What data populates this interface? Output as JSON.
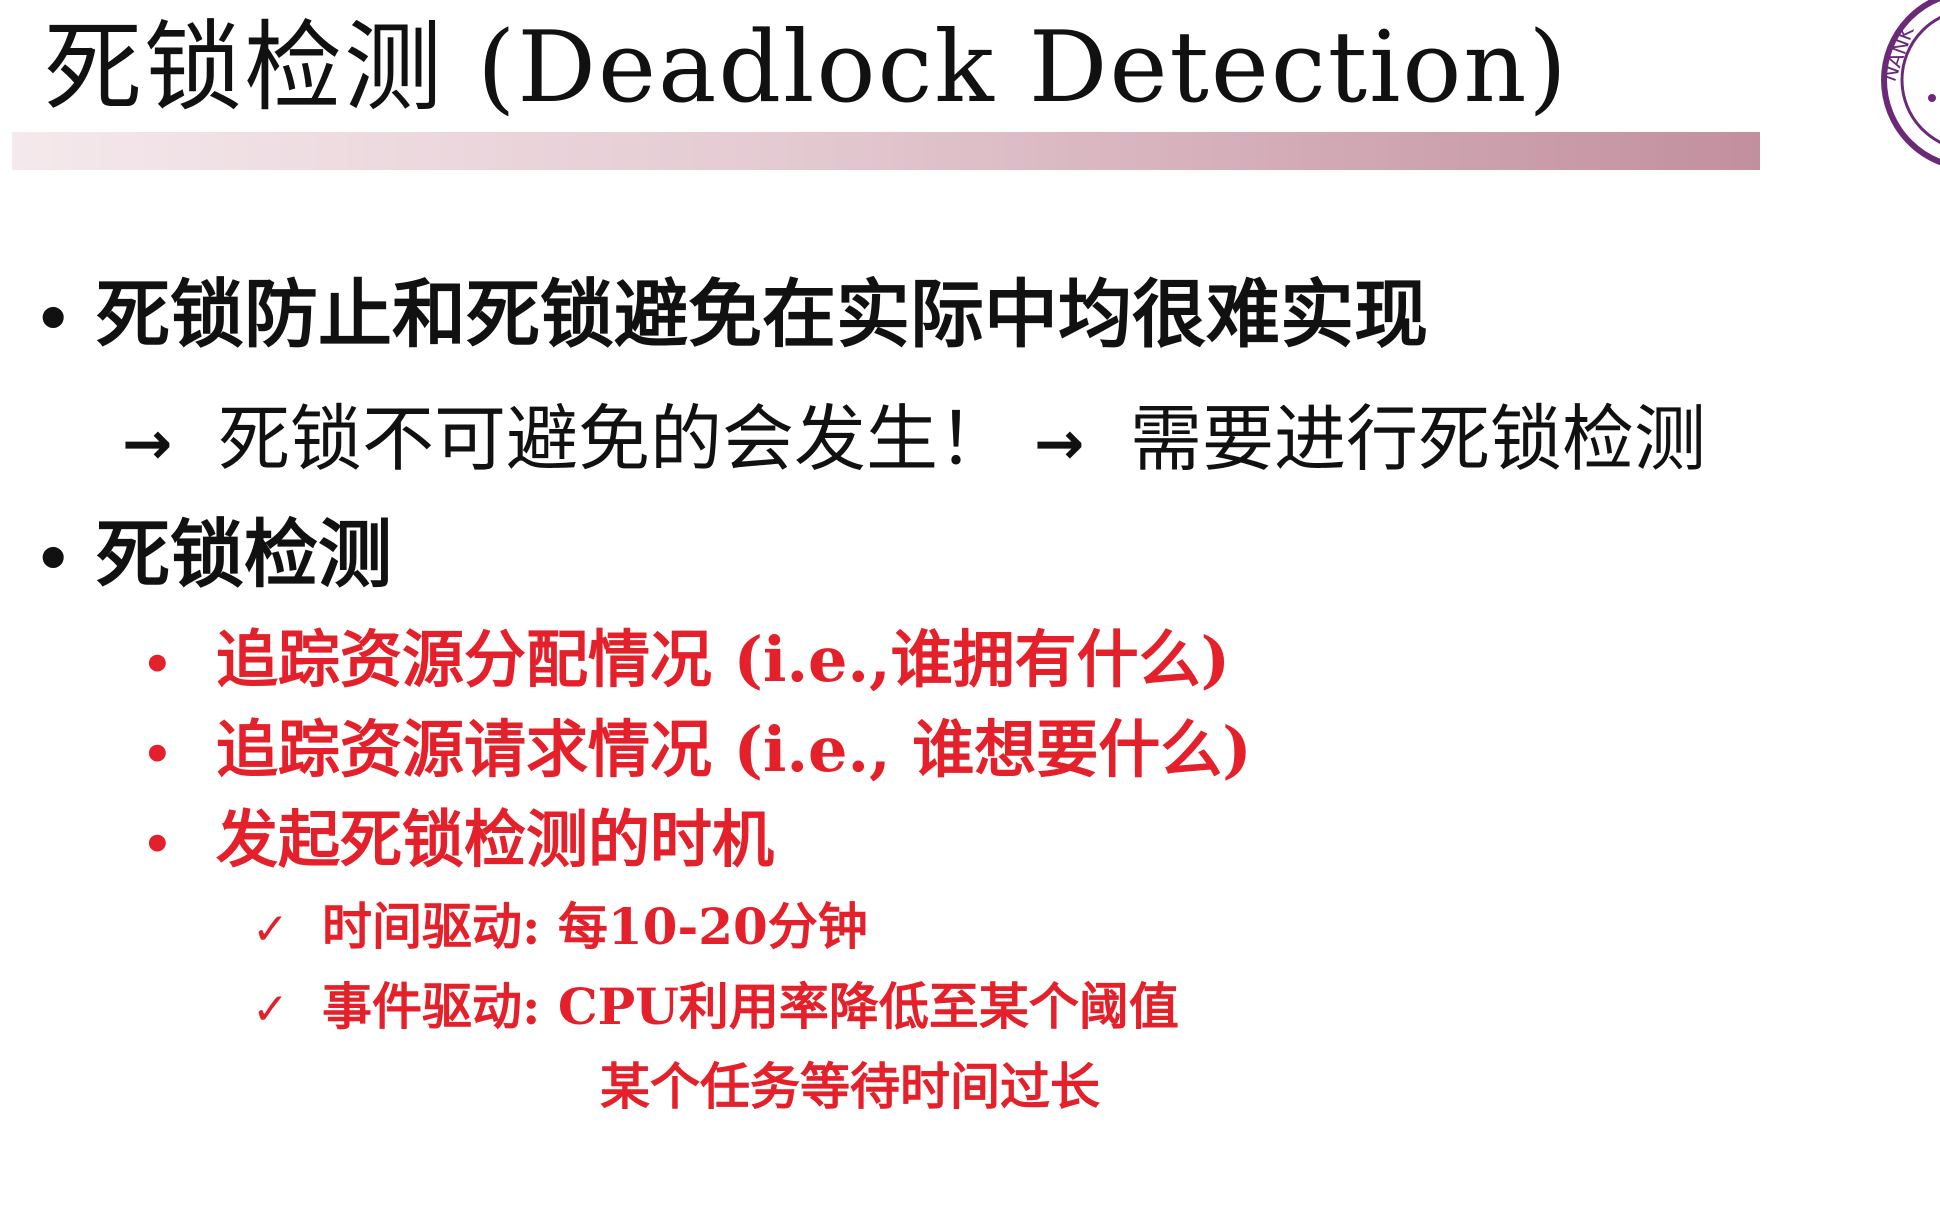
{
  "slide": {
    "title": "死锁检测  (Deadlock Detection)",
    "logo_text": "NANK",
    "bullet_1": "死锁防止和死锁避免在实际中均很难实现",
    "arrow_line": {
      "part_1": "死锁不可避免的会发生！",
      "part_2": "需要进行死锁检测"
    },
    "bullet_2": "死锁检测",
    "sub_bullets": [
      "追踪资源分配情况 (i.e.,谁拥有什么)",
      "追踪资源请求情况 (i.e., 谁想要什么)",
      "发起死锁检测的时机"
    ],
    "check_items": [
      "时间驱动: 每10-20分钟",
      "事件驱动: CPU利用率降低至某个阈值"
    ],
    "continuation": "某个任务等待时间过长"
  },
  "colors": {
    "text": "#111111",
    "accent_red": "#e4202a",
    "title_bar_start": "#f4e9ec",
    "title_bar_end": "#c28f9e",
    "logo_purple": "#6b2a78"
  },
  "icons": {
    "bullet": "•",
    "arrow": "→",
    "check": "✓"
  }
}
